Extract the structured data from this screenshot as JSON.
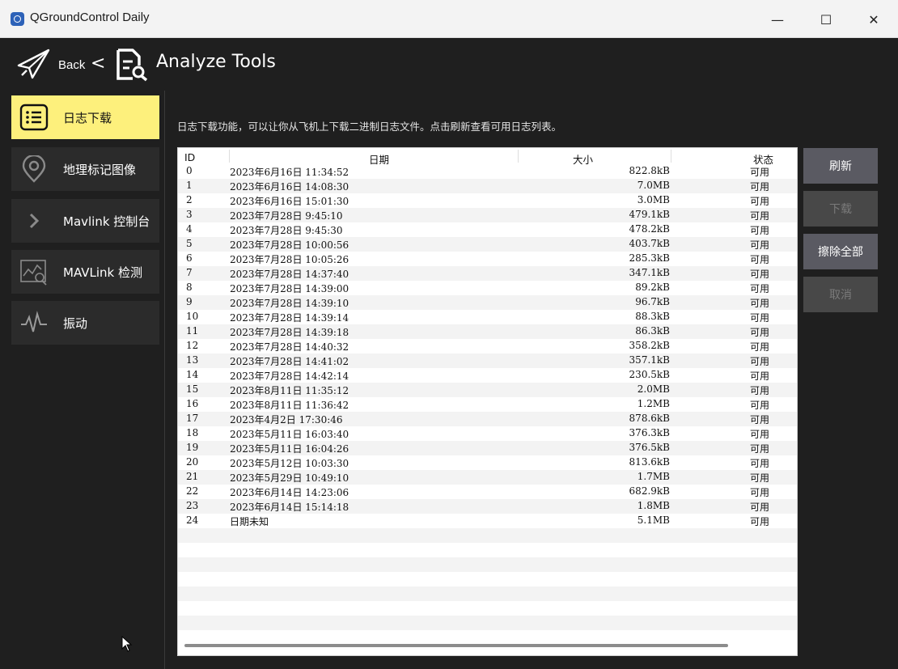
{
  "window": {
    "title": "QGroundControl Daily",
    "controls": {
      "minimize": "—",
      "maximize": "☐",
      "close": "✕"
    }
  },
  "header": {
    "back_label": "Back",
    "separator": "<",
    "title": "Analyze Tools",
    "icons": [
      "paper-plane-icon",
      "document-search-icon"
    ]
  },
  "sidebar": {
    "items": [
      {
        "label": "日志下载",
        "icon": "list-icon",
        "active": true
      },
      {
        "label": "地理标记图像",
        "icon": "location-pin-icon",
        "active": false
      },
      {
        "label": "Mavlink 控制台",
        "icon": "chevron-right-icon",
        "active": false
      },
      {
        "label": "MAVLink 检测",
        "icon": "chart-inspect-icon",
        "active": false
      },
      {
        "label": "振动",
        "icon": "waveform-icon",
        "active": false
      }
    ]
  },
  "main": {
    "description": "日志下载功能，可以让你从飞机上下载二进制日志文件。点击刷新查看可用日志列表。",
    "table": {
      "columns": {
        "id": "ID",
        "date": "日期",
        "size": "大小",
        "status": "状态"
      },
      "rows": [
        {
          "id": "0",
          "date": "2023年6月16日 11:34:52",
          "size": "822.8kB",
          "status": "可用"
        },
        {
          "id": "1",
          "date": "2023年6月16日 14:08:30",
          "size": "7.0MB",
          "status": "可用"
        },
        {
          "id": "2",
          "date": "2023年6月16日 15:01:30",
          "size": "3.0MB",
          "status": "可用"
        },
        {
          "id": "3",
          "date": "2023年7月28日 9:45:10",
          "size": "479.1kB",
          "status": "可用"
        },
        {
          "id": "4",
          "date": "2023年7月28日 9:45:30",
          "size": "478.2kB",
          "status": "可用"
        },
        {
          "id": "5",
          "date": "2023年7月28日 10:00:56",
          "size": "403.7kB",
          "status": "可用"
        },
        {
          "id": "6",
          "date": "2023年7月28日 10:05:26",
          "size": "285.3kB",
          "status": "可用"
        },
        {
          "id": "7",
          "date": "2023年7月28日 14:37:40",
          "size": "347.1kB",
          "status": "可用"
        },
        {
          "id": "8",
          "date": "2023年7月28日 14:39:00",
          "size": "89.2kB",
          "status": "可用"
        },
        {
          "id": "9",
          "date": "2023年7月28日 14:39:10",
          "size": "96.7kB",
          "status": "可用"
        },
        {
          "id": "10",
          "date": "2023年7月28日 14:39:14",
          "size": "88.3kB",
          "status": "可用"
        },
        {
          "id": "11",
          "date": "2023年7月28日 14:39:18",
          "size": "86.3kB",
          "status": "可用"
        },
        {
          "id": "12",
          "date": "2023年7月28日 14:40:32",
          "size": "358.2kB",
          "status": "可用"
        },
        {
          "id": "13",
          "date": "2023年7月28日 14:41:02",
          "size": "357.1kB",
          "status": "可用"
        },
        {
          "id": "14",
          "date": "2023年7月28日 14:42:14",
          "size": "230.5kB",
          "status": "可用"
        },
        {
          "id": "15",
          "date": "2023年8月11日 11:35:12",
          "size": "2.0MB",
          "status": "可用"
        },
        {
          "id": "16",
          "date": "2023年8月11日 11:36:42",
          "size": "1.2MB",
          "status": "可用"
        },
        {
          "id": "17",
          "date": "2023年4月2日 17:30:46",
          "size": "878.6kB",
          "status": "可用"
        },
        {
          "id": "18",
          "date": "2023年5月11日 16:03:40",
          "size": "376.3kB",
          "status": "可用"
        },
        {
          "id": "19",
          "date": "2023年5月11日 16:04:26",
          "size": "376.5kB",
          "status": "可用"
        },
        {
          "id": "20",
          "date": "2023年5月12日 10:03:30",
          "size": "813.6kB",
          "status": "可用"
        },
        {
          "id": "21",
          "date": "2023年5月29日 10:49:10",
          "size": "1.7MB",
          "status": "可用"
        },
        {
          "id": "22",
          "date": "2023年6月14日 14:23:06",
          "size": "682.9kB",
          "status": "可用"
        },
        {
          "id": "23",
          "date": "2023年6月14日 15:14:18",
          "size": "1.8MB",
          "status": "可用"
        },
        {
          "id": "24",
          "date": "日期未知",
          "size": "5.1MB",
          "status": "可用"
        },
        {
          "id": "",
          "date": "",
          "size": "",
          "status": ""
        },
        {
          "id": "",
          "date": "",
          "size": "",
          "status": ""
        },
        {
          "id": "",
          "date": "",
          "size": "",
          "status": ""
        },
        {
          "id": "",
          "date": "",
          "size": "",
          "status": ""
        },
        {
          "id": "",
          "date": "",
          "size": "",
          "status": ""
        },
        {
          "id": "",
          "date": "",
          "size": "",
          "status": ""
        },
        {
          "id": "",
          "date": "",
          "size": "",
          "status": ""
        },
        {
          "id": "",
          "date": "",
          "size": "",
          "status": ""
        }
      ]
    }
  },
  "actions": {
    "refresh": {
      "label": "刷新",
      "enabled": true
    },
    "download": {
      "label": "下载",
      "enabled": false
    },
    "erase_all": {
      "label": "擦除全部",
      "enabled": true
    },
    "cancel": {
      "label": "取消",
      "enabled": false
    }
  },
  "colors": {
    "background": "#1f1f1f",
    "active_tab": "#fdf07c",
    "sidebar_item": "#2b2b2b",
    "button_enabled": "#5a5a62",
    "button_disabled": "#484848"
  }
}
